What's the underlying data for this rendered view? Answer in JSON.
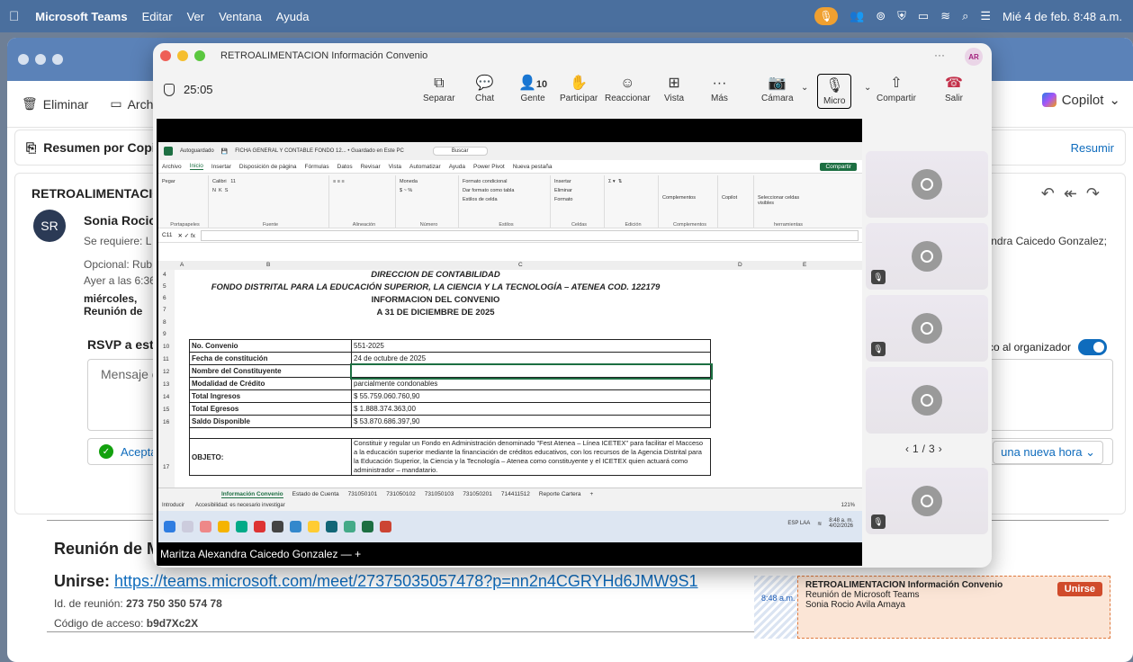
{
  "menubar": {
    "app": "Microsoft Teams",
    "items": [
      "Editar",
      "Ver",
      "Ventana",
      "Ayuda"
    ],
    "clock": "Mié 4 de feb. 8:48 a.m."
  },
  "outlook": {
    "toolbar": {
      "delete": "Eliminar",
      "archive": "Arch",
      "copilot": "Copilot"
    },
    "summary": {
      "label": "Resumen por Copi",
      "action": "Resumir"
    },
    "mail": {
      "subject": "RETROALIMENTACIOI",
      "avatar_initials": "SR",
      "sender": "Sonia Rocio",
      "required_label": "Se requiere:",
      "required_values": "L",
      "attendee_tail": "ndra Caicedo Gonzalez;",
      "optional_label": "Opcional:",
      "optional_value": "Rub",
      "received": "Ayer a las 6:36 p",
      "when_line1": "miércoles,",
      "when_line2": "Reunión de"
    },
    "rsvp": {
      "title": "RSVP a este",
      "notify_label": "co al organizador",
      "message_placeholder": "Mensaje o",
      "accept": "Acepta",
      "new_time": "una nueva hora"
    },
    "meeting": {
      "title": "Reunión de Mi",
      "join_label": "Unirse:",
      "join_url": "https://teams.microsoft.com/meet/27375035057478?p=nn2n4CGRYHd6JMW9S1",
      "meeting_id_label": "Id. de reunión:",
      "meeting_id": "273 750 350 574 78",
      "access_label": "Código de acceso:",
      "access_code": "b9d7Xc2X"
    },
    "calendar_event": {
      "time": "8:48 a.m.",
      "title": "RETROALIMENTACION Información Convenio",
      "subtitle": "Reunión de Microsoft Teams",
      "organizer": "Sonia Rocio Avila Amaya",
      "join_button": "Unirse"
    }
  },
  "teams": {
    "window_title": "RETROALIMENTACION Información Convenio",
    "more": "···",
    "user_initials": "AR",
    "timer": "25:05",
    "controls": {
      "separate": "Separar",
      "chat": "Chat",
      "people": "Gente",
      "people_count": "10",
      "raise": "Participar",
      "react": "Reaccionar",
      "view": "Vista",
      "more": "Más",
      "camera": "Cámara",
      "micro": "Micro",
      "share": "Compartir",
      "leave": "Salir"
    },
    "presenter_name": "Maritza Alexandra Caicedo Gonzalez",
    "pager": "1/3",
    "tiles": [
      {
        "muted": false
      },
      {
        "muted": true
      },
      {
        "muted": true
      },
      {
        "muted": false
      },
      {
        "muted": true
      }
    ]
  },
  "excel": {
    "autosave": "Autoguardado",
    "file_name": "FICHA GENERAL Y CONTABLE FONDO 12... • Guardado en Este PC",
    "search": "Buscar",
    "menu": [
      "Archivo",
      "Inicio",
      "Insertar",
      "Disposición de página",
      "Fórmulas",
      "Datos",
      "Revisar",
      "Vista",
      "Automatizar",
      "Ayuda",
      "Power Pivot",
      "Nueva pestaña"
    ],
    "comments": "Comentarios",
    "share": "Compartir",
    "ribbon": {
      "clipboard": "Portapapeles",
      "paste": "Pegar",
      "font_group": "Fuente",
      "font_name": "Calibri",
      "font_size": "11",
      "align_group": "Alineación",
      "number_group": "Número",
      "number_format": "Moneda",
      "styles_group": "Estilos",
      "styles_items": [
        "Formato condicional",
        "Dar formato como tabla",
        "Estilos de celda"
      ],
      "cells_group": "Celdas",
      "cells_items": [
        "Insertar",
        "Eliminar",
        "Formato"
      ],
      "edit_group": "Edición",
      "addins": "Complementos",
      "copilot": "Copilot",
      "select": "Seleccionar celdas visibles",
      "tools": "herramientas"
    },
    "cell_ref": "C11",
    "columns": [
      "A",
      "B",
      "C",
      "D",
      "E"
    ],
    "rows": [
      "4",
      "5",
      "6",
      "7",
      "8",
      "9",
      "10",
      "11",
      "12",
      "13",
      "14",
      "15",
      "16",
      "17"
    ],
    "header_lines": [
      "DIRECCION DE CONTABILIDAD",
      "FONDO DISTRITAL PARA LA EDUCACIÓN SUPERIOR, LA CIENCIA Y LA TECNOLOGÍA – ATENEA COD. 122179",
      "INFORMACION DEL CONVENIO",
      "A 31 DE DICIEMBRE DE 2025"
    ],
    "table": [
      {
        "k": "No. Convenio",
        "v": "551-2025"
      },
      {
        "k": "Fecha de constitución",
        "v": "24 de octubre de 2025"
      },
      {
        "k": "Nombre del Constituyente",
        "v": ""
      },
      {
        "k": "Modalidad de Crédito",
        "v": "parcialmente condonables"
      },
      {
        "k": "Total Ingresos",
        "v": "$ 55.759.060.760,90"
      },
      {
        "k": "Total Egresos",
        "v": "$ 1.888.374.363,00"
      },
      {
        "k": "Saldo Disponible",
        "v": "$ 53.870.686.397,90"
      }
    ],
    "objeto_label": "OBJETO:",
    "objeto_text": "Constituir y regular un Fondo en Administración denominado \"Fest Atenea – Línea ICETEX\" para facilitar el Macceso a la educación superior mediante la financiación de créditos educativos, con los recursos de la Agencia Distrital para la Educación Superior, la Ciencia y la Tecnología – Atenea como constituyente y el ICETEX quien actuará como administrador – mandatario.",
    "sheet_tabs": [
      "Información Convenio",
      "Estado de Cuenta",
      "731050101",
      "731050102",
      "731050103",
      "731050201",
      "714411512",
      "Reporte Cartera"
    ],
    "status_mode": "Introducir",
    "status_accessibility": "Accesibilidad: es necesario investigar",
    "zoom": "121%",
    "tray_lang": "ESP LAA",
    "tray_time": "8:48 a. m.",
    "tray_date": "4/02/2026"
  }
}
